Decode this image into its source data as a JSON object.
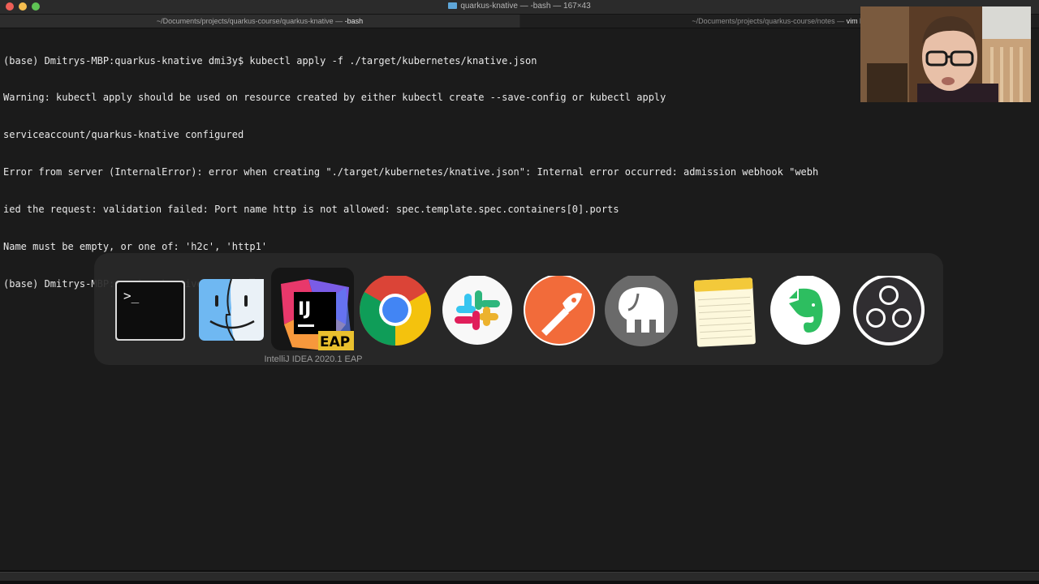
{
  "window": {
    "title": "quarkus-knative — -bash — 167×43"
  },
  "tabs": [
    {
      "path": "~/Documents/projects/quarkus-course/quarkus-knative — ",
      "command": "-bash"
    },
    {
      "path": "~/Documents/projects/quarkus-course/notes — ",
      "command": "vim kn"
    }
  ],
  "terminal": {
    "lines": [
      "(base) Dmitrys-MBP:quarkus-knative dmi3y$ kubectl apply -f ./target/kubernetes/knative.json",
      "Warning: kubectl apply should be used on resource created by either kubectl create --save-config or kubectl apply",
      "serviceaccount/quarkus-knative configured",
      "Error from server (InternalError): error when creating \"./target/kubernetes/knative.json\": Internal error occurred: admission webhook \"webh",
      "ied the request: validation failed: Port name http is not allowed: spec.template.spec.containers[0].ports",
      "Name must be empty, or one of: 'h2c', 'http1'",
      "(base) Dmitrys-MBP:quarkus-knative dmi3y$ "
    ]
  },
  "app_switcher": {
    "selected_label": "IntelliJ IDEA 2020.1 EAP",
    "apps": [
      {
        "icon": "terminal-icon"
      },
      {
        "icon": "finder-icon"
      },
      {
        "icon": "intellij-idea-eap-icon",
        "badge": "EAP",
        "mark": "IJ"
      },
      {
        "icon": "chrome-icon"
      },
      {
        "icon": "slack-icon"
      },
      {
        "icon": "postman-icon"
      },
      {
        "icon": "mamp-icon"
      },
      {
        "icon": "notes-icon"
      },
      {
        "icon": "evernote-icon"
      },
      {
        "icon": "obs-icon"
      }
    ]
  },
  "colors": {
    "terminal_bg": "#1b1b1b",
    "terminal_text": "#e9e9e9",
    "chrome_red": "#db4437",
    "chrome_yellow": "#f4c20d",
    "chrome_green": "#0f9d58",
    "chrome_blue": "#4285f4",
    "postman_orange": "#f26b3a",
    "evernote_green": "#2dbe60"
  }
}
